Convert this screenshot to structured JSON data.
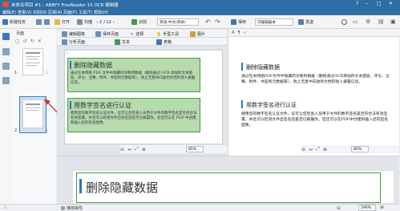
{
  "titlebar": {
    "title": "未命名项目 #1 - ABBYY FineReader 15 OCR 编辑器"
  },
  "menu": [
    "编辑(E)",
    "查看(V)",
    "识别(R)",
    "区域(A)",
    "页面(P)",
    "工具(T)",
    "帮助(H)"
  ],
  "toolbar": {
    "new_task": "新建任务",
    "open": "打开",
    "scan": "扫描",
    "page_current": "2",
    "page_total": "/ 12",
    "recognize": "识别",
    "language": "英语;中文(简体)",
    "save": "保存",
    "format": "可编辑副本",
    "send": "发送"
  },
  "left": {
    "pages_label": "页面"
  },
  "thumbs": [
    {
      "num": "1"
    },
    {
      "num": "2"
    }
  ],
  "img_toolbar": {
    "edit_image": "编辑图像",
    "save_page": "保存页面",
    "analyze": "分析页面",
    "select": "选择",
    "manual": "手型工具",
    "text": "文本",
    "picture": "图片",
    "table": "表格"
  },
  "doc": {
    "heading1": "删除隐藏数据",
    "para1": "通过在本网络 PDF 文件中隐藏的对象和数据（删除通过 OCR 添加的文本图层、评论、注释、附件、书签和元数据等），防止无意中向收到文档的他人披露信息。",
    "heading2": "用数字签名进行认证",
    "para2": "使用您的数字签名认证文件。证可让您检查人员用于文件的数字签名是否符合法有效签署，并且可以检测文件自签名后是否已被篡改。您还可以在 PDF 中创建和插入您的签名图像。"
  },
  "text_pane": {
    "heading1": "删除隐藏数据",
    "para1": "通过在本网络PDF文件中隐藏的对象和数据（删除通过OCR添加的文本图层、评论、注释、附件、书签和元数据等），防止无意中向收到文档的他人披露信息。",
    "heading2": "用数字签名进行认证",
    "para2": "使用您的数字签名认证文件。证可让您检查人员用于文件的数字签名是否符合法有效签署，并且可以检测文件自签名后是否已被篡改。您还可以在PDF中创建和插入您的签名图像。"
  },
  "zoom": {
    "img": "85%",
    "text": "85%",
    "bottom": "196%"
  },
  "bottom": {
    "heading": "删除隐藏数据"
  },
  "status": {
    "warning": "⚠",
    "label": "播放属性"
  },
  "colors": {
    "accent": "#2f6ea5",
    "zone": "#4a9a43",
    "arrow": "#c0392b"
  }
}
